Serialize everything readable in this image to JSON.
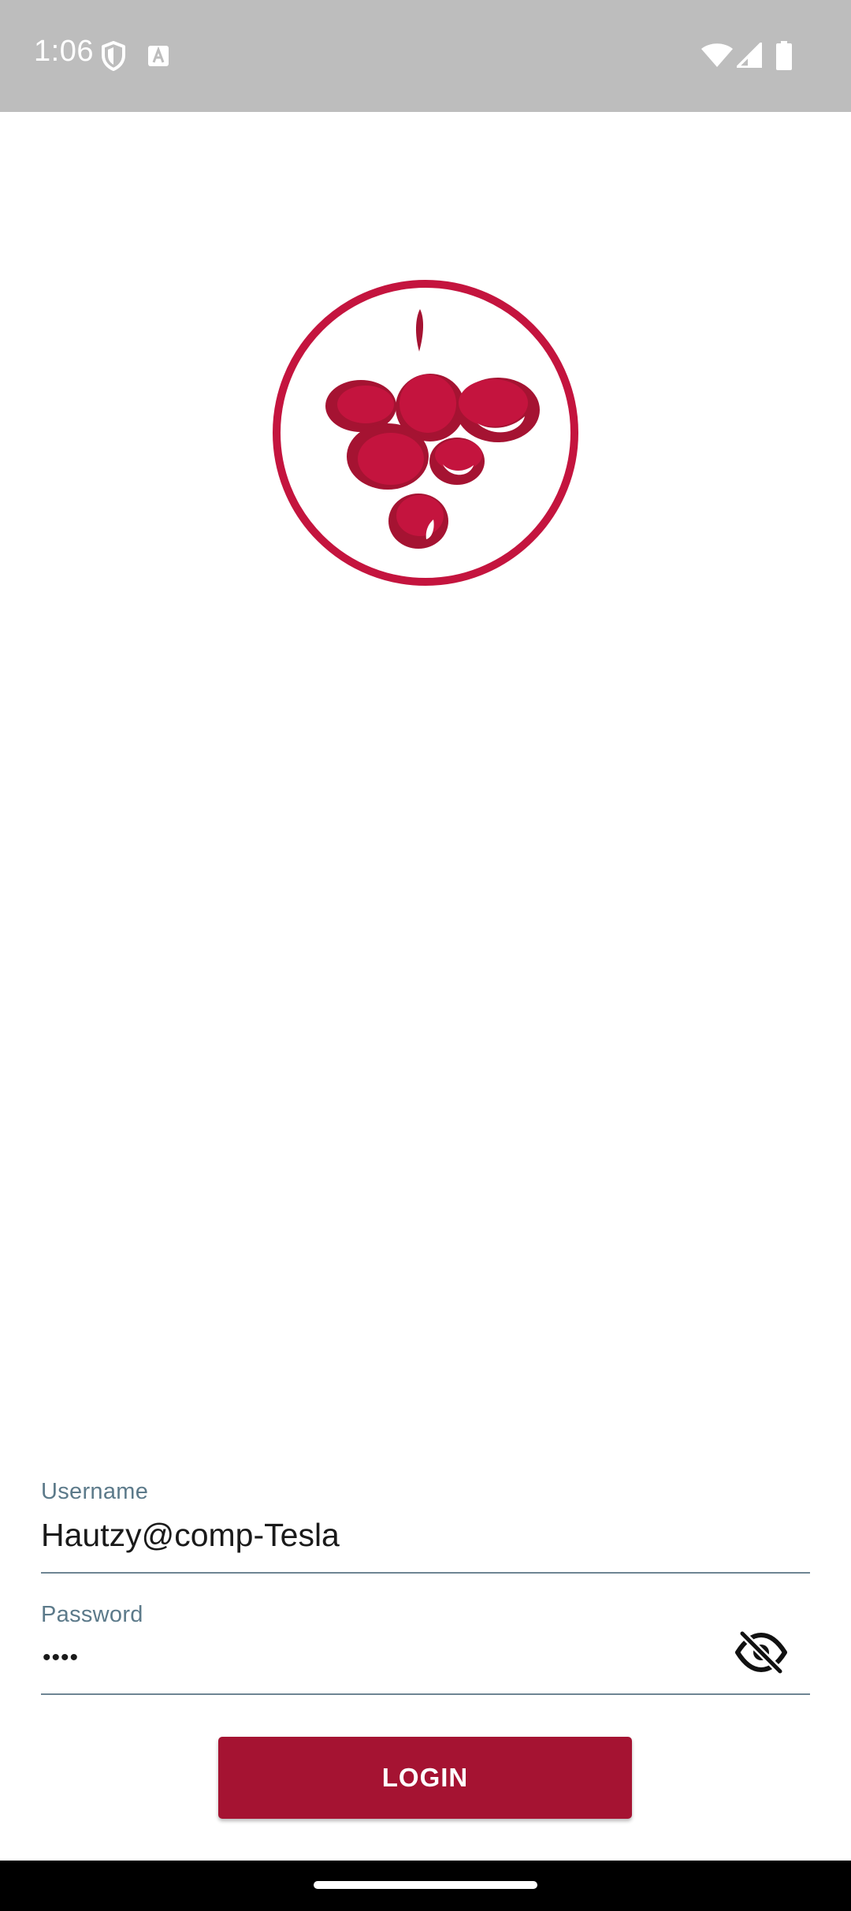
{
  "status_bar": {
    "time": "1:06",
    "icons": [
      "shield-icon",
      "keyboard-a-icon",
      "wifi-icon",
      "signal-icon",
      "battery-icon"
    ]
  },
  "logo": {
    "icon": "grape-bunch-icon",
    "color": "#c4143e"
  },
  "form": {
    "username": {
      "label": "Username",
      "value": "Hautzy@comp-Tesla"
    },
    "password": {
      "label": "Password",
      "masked_value": "••••",
      "toggle_icon": "visibility-off-icon"
    },
    "login_label": "LOGIN"
  },
  "colors": {
    "accent": "#a51332",
    "label": "#5c7a8a",
    "status_bar_bg": "#bdbdbd"
  }
}
